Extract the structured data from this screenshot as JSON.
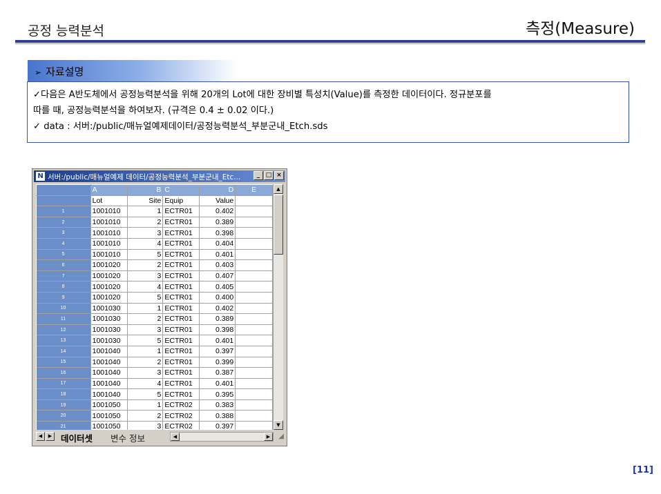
{
  "slide": {
    "title": "공정 능력분석",
    "subtitle": "측정(Measure)",
    "page_number": "[11]"
  },
  "section": {
    "arrow": "➢",
    "label": "자료설명"
  },
  "description": {
    "line1": "✓다음은 A반도체에서 공정능력분석을 위해 20개의 Lot에 대한 장비별 특성치(Value)를 측정한 데이터이다. 정규분포를",
    "line2": "따를 때, 공정능력분석을 하여보자. (규격은 0.4 ± 0.02 이다.)",
    "line3": "✓ data : 서버:/public/매뉴얼예제데이터/공정능력분석_부분군내_Etch.sds"
  },
  "window": {
    "title": "서버:/public/매뉴얼예제 데이터/공정능력분석_부분군내_Etc...",
    "app_icon": "N",
    "minimize": "_",
    "maximize": "□",
    "close": "×"
  },
  "grid": {
    "columns": [
      "A",
      "B",
      "C",
      "D",
      "E"
    ],
    "fields": [
      "Lot",
      "Site",
      "Equip",
      "Value",
      ""
    ],
    "rows": [
      {
        "n": "1",
        "lot": "1001010",
        "site": "1",
        "equip": "ECTR01",
        "value": "0.402"
      },
      {
        "n": "2",
        "lot": "1001010",
        "site": "2",
        "equip": "ECTR01",
        "value": "0.389"
      },
      {
        "n": "3",
        "lot": "1001010",
        "site": "3",
        "equip": "ECTR01",
        "value": "0.398"
      },
      {
        "n": "4",
        "lot": "1001010",
        "site": "4",
        "equip": "ECTR01",
        "value": "0.404"
      },
      {
        "n": "5",
        "lot": "1001010",
        "site": "5",
        "equip": "ECTR01",
        "value": "0.401"
      },
      {
        "n": "6",
        "lot": "1001020",
        "site": "2",
        "equip": "ECTR01",
        "value": "0.403"
      },
      {
        "n": "7",
        "lot": "1001020",
        "site": "3",
        "equip": "ECTR01",
        "value": "0.407"
      },
      {
        "n": "8",
        "lot": "1001020",
        "site": "4",
        "equip": "ECTR01",
        "value": "0.405"
      },
      {
        "n": "9",
        "lot": "1001020",
        "site": "5",
        "equip": "ECTR01",
        "value": "0.400"
      },
      {
        "n": "10",
        "lot": "1001030",
        "site": "1",
        "equip": "ECTR01",
        "value": "0.402"
      },
      {
        "n": "11",
        "lot": "1001030",
        "site": "2",
        "equip": "ECTR01",
        "value": "0.389"
      },
      {
        "n": "12",
        "lot": "1001030",
        "site": "3",
        "equip": "ECTR01",
        "value": "0.398"
      },
      {
        "n": "13",
        "lot": "1001030",
        "site": "5",
        "equip": "ECTR01",
        "value": "0.401"
      },
      {
        "n": "14",
        "lot": "1001040",
        "site": "1",
        "equip": "ECTR01",
        "value": "0.397"
      },
      {
        "n": "15",
        "lot": "1001040",
        "site": "2",
        "equip": "ECTR01",
        "value": "0.399"
      },
      {
        "n": "16",
        "lot": "1001040",
        "site": "3",
        "equip": "ECTR01",
        "value": "0.387"
      },
      {
        "n": "17",
        "lot": "1001040",
        "site": "4",
        "equip": "ECTR01",
        "value": "0.401"
      },
      {
        "n": "18",
        "lot": "1001040",
        "site": "5",
        "equip": "ECTR01",
        "value": "0.395"
      },
      {
        "n": "19",
        "lot": "1001050",
        "site": "1",
        "equip": "ECTR02",
        "value": "0.383"
      },
      {
        "n": "20",
        "lot": "1001050",
        "site": "2",
        "equip": "ECTR02",
        "value": "0.388"
      },
      {
        "n": "21",
        "lot": "1001050",
        "site": "3",
        "equip": "ECTR02",
        "value": "0.397"
      }
    ]
  },
  "sheet_tabs": {
    "active": "데이터셋",
    "inactive": "변수 정보"
  },
  "colors": {
    "accent": "#2e3f98",
    "page_number": "#1d35a8",
    "header_blue": "#6c8ec8"
  }
}
